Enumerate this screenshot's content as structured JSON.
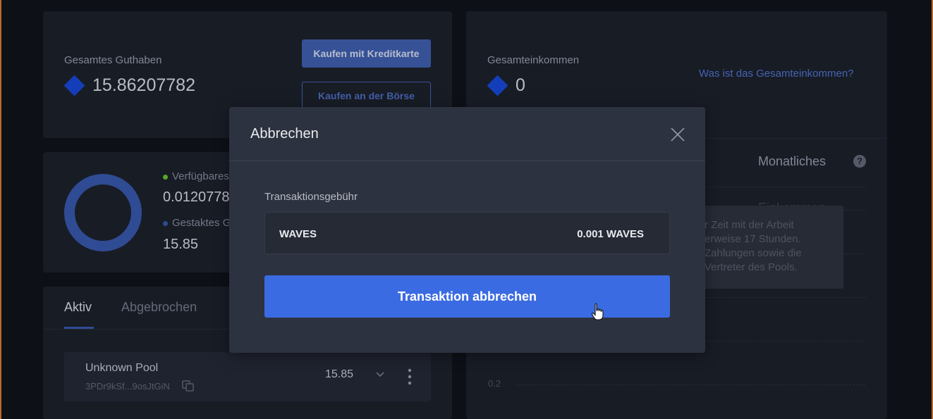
{
  "balance": {
    "label": "Gesamtes Guthaben",
    "value": "15.86207782",
    "buy_card_label": "Kaufen mit Kreditkarte",
    "buy_exchange_label": "Kaufen an der Börse"
  },
  "income": {
    "label": "Gesamteinkommen",
    "value": "0",
    "help_link": "Was ist das Gesamteinkommen?"
  },
  "distribution": {
    "available_label": "Verfügbares",
    "available_value": "0.0120778",
    "staked_label": "Gestaktes G",
    "staked_value": "15.85",
    "available_color": "#5fb829",
    "staked_color": "#3452a0"
  },
  "tabs": [
    {
      "label": "Aktiv",
      "active": true
    },
    {
      "label": "Abgebrochen",
      "active": false
    }
  ],
  "pools": [
    {
      "name": "Unknown Pool",
      "address": "3PDr9kSf...9osJtGiN",
      "amount": "15.85"
    }
  ],
  "chart_panel": {
    "monthly_label": "Monatliches",
    "income_label": "Einkommen",
    "tooltip_lines": [
      "r Zeit mit der Arbeit",
      "erweise 17 Stunden.",
      "Zahlungen sowie die",
      "Vertreter des Pools."
    ],
    "y_tick": "0.2"
  },
  "modal": {
    "title": "Abbrechen",
    "fee_label": "Transaktionsgebühr",
    "fee_asset": "WAVES",
    "fee_amount": "0.001 WAVES",
    "confirm_label": "Transaktion abbrechen"
  },
  "colors": {
    "accent": "#3b6be2",
    "waves_blue": "#1644c9"
  }
}
